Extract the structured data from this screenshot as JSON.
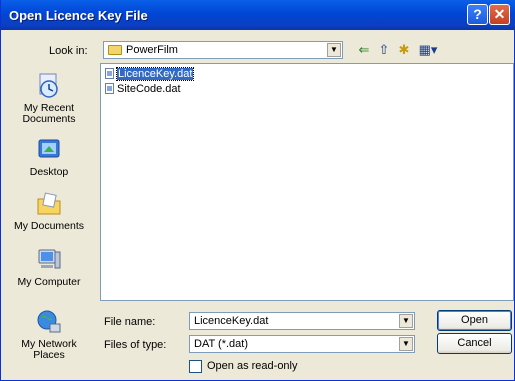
{
  "window": {
    "title": "Open Licence Key File",
    "help_glyph": "?",
    "close_glyph": "✕"
  },
  "lookin": {
    "label": "Look in:",
    "value": "PowerFilm"
  },
  "toolbar": {
    "back": "⇐",
    "up": "⇧",
    "new_folder": "✱",
    "view": "▦▾"
  },
  "places": [
    {
      "name": "recent",
      "label": "My Recent Documents"
    },
    {
      "name": "desktop",
      "label": "Desktop"
    },
    {
      "name": "documents",
      "label": "My Documents"
    },
    {
      "name": "computer",
      "label": "My Computer"
    },
    {
      "name": "network",
      "label": "My Network Places"
    }
  ],
  "files": [
    {
      "name": "LicenceKey.dat",
      "selected": true
    },
    {
      "name": "SiteCode.dat",
      "selected": false
    }
  ],
  "filename": {
    "label": "File name:",
    "value": "LicenceKey.dat"
  },
  "filetype": {
    "label": "Files of type:",
    "value": "DAT (*.dat)"
  },
  "readonly": {
    "label": "Open as read-only",
    "checked": false
  },
  "buttons": {
    "open": "Open",
    "cancel": "Cancel"
  },
  "combo_arrow": "▼"
}
